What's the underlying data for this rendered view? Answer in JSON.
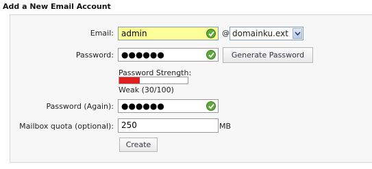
{
  "title": "Add a New Email Account",
  "email": {
    "label": "Email:",
    "value": "admin",
    "at": "@",
    "domain": "domainku.ext"
  },
  "password": {
    "label": "Password:",
    "masked": "●●●●●●",
    "generate_label": "Generate Password"
  },
  "strength": {
    "label": "Password Strength:",
    "text": "Weak (30/100)",
    "level": 0.3,
    "color": "#e11d1d"
  },
  "password_again": {
    "label": "Password (Again):",
    "masked": "●●●●●●"
  },
  "quota": {
    "label": "Mailbox quota (optional):",
    "value": "250",
    "unit": "MB"
  },
  "create_label": "Create",
  "icons": {
    "valid": "check-circle-icon",
    "dropdown": "chevron-down-icon"
  }
}
